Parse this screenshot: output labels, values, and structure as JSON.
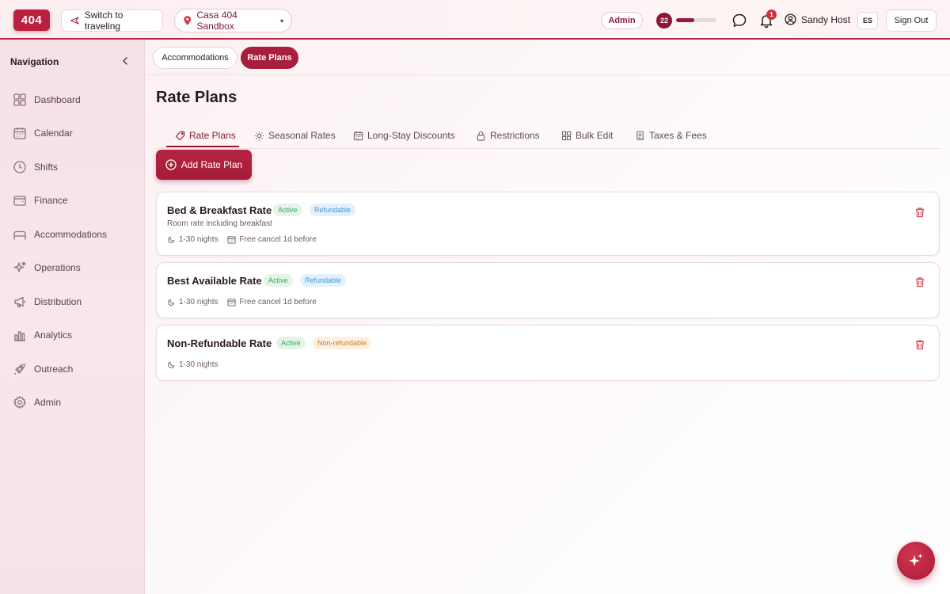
{
  "topbar": {
    "logo": "404",
    "switch_label": "Switch to traveling",
    "property_label": "Casa 404 Sandbox",
    "property_caret": "▾",
    "role_badge": "Admin",
    "level": "22",
    "level_progress": 0.45,
    "notification_count": "1",
    "user_name": "Sandy Host",
    "language": "ES",
    "signout_label": "Sign Out"
  },
  "sidebar": {
    "title": "Navigation",
    "items": [
      {
        "label": "Dashboard",
        "icon": "grid-icon"
      },
      {
        "label": "Calendar",
        "icon": "calendar-icon"
      },
      {
        "label": "Shifts",
        "icon": "clock-icon"
      },
      {
        "label": "Finance",
        "icon": "wallet-icon"
      },
      {
        "label": "Accommodations",
        "icon": "bed-icon"
      },
      {
        "label": "Operations",
        "icon": "sparkles-icon"
      },
      {
        "label": "Distribution",
        "icon": "megaphone-icon"
      },
      {
        "label": "Analytics",
        "icon": "bar-chart-icon"
      },
      {
        "label": "Outreach",
        "icon": "rocket-icon"
      },
      {
        "label": "Admin",
        "icon": "gear-icon"
      }
    ]
  },
  "subtabs": {
    "accommodations": "Accommodations",
    "rate_plans": "Rate Plans"
  },
  "page": {
    "title": "Rate Plans"
  },
  "tabs": [
    {
      "label": "Rate Plans",
      "icon": "tag-icon"
    },
    {
      "label": "Seasonal Rates",
      "icon": "sun-icon"
    },
    {
      "label": "Long-Stay Discounts",
      "icon": "calendar-icon"
    },
    {
      "label": "Restrictions",
      "icon": "lock-icon"
    },
    {
      "label": "Bulk Edit",
      "icon": "grid-icon"
    },
    {
      "label": "Taxes & Fees",
      "icon": "receipt-icon"
    }
  ],
  "add_button": "Add Rate Plan",
  "rate_plans": [
    {
      "name": "Bed & Breakfast Rate",
      "status": "Active",
      "refund": "Refundable",
      "description": "Room rate including breakfast",
      "nights": "1-30 nights",
      "cancel": "Free cancel 1d before"
    },
    {
      "name": "Best Available Rate",
      "status": "Active",
      "refund": "Refundable",
      "nights": "1-30 nights",
      "cancel": "Free cancel 1d before"
    },
    {
      "name": "Non-Refundable Rate",
      "status": "Active",
      "refund": "Non-refundable",
      "nights": "1-30 nights"
    }
  ],
  "colors": {
    "brand": "#a81e3c",
    "active_badge": "#3aa560",
    "refundable_badge": "#3c9ad6",
    "nonrefundable_badge": "#cc7b25",
    "trash": "#d9434f"
  }
}
